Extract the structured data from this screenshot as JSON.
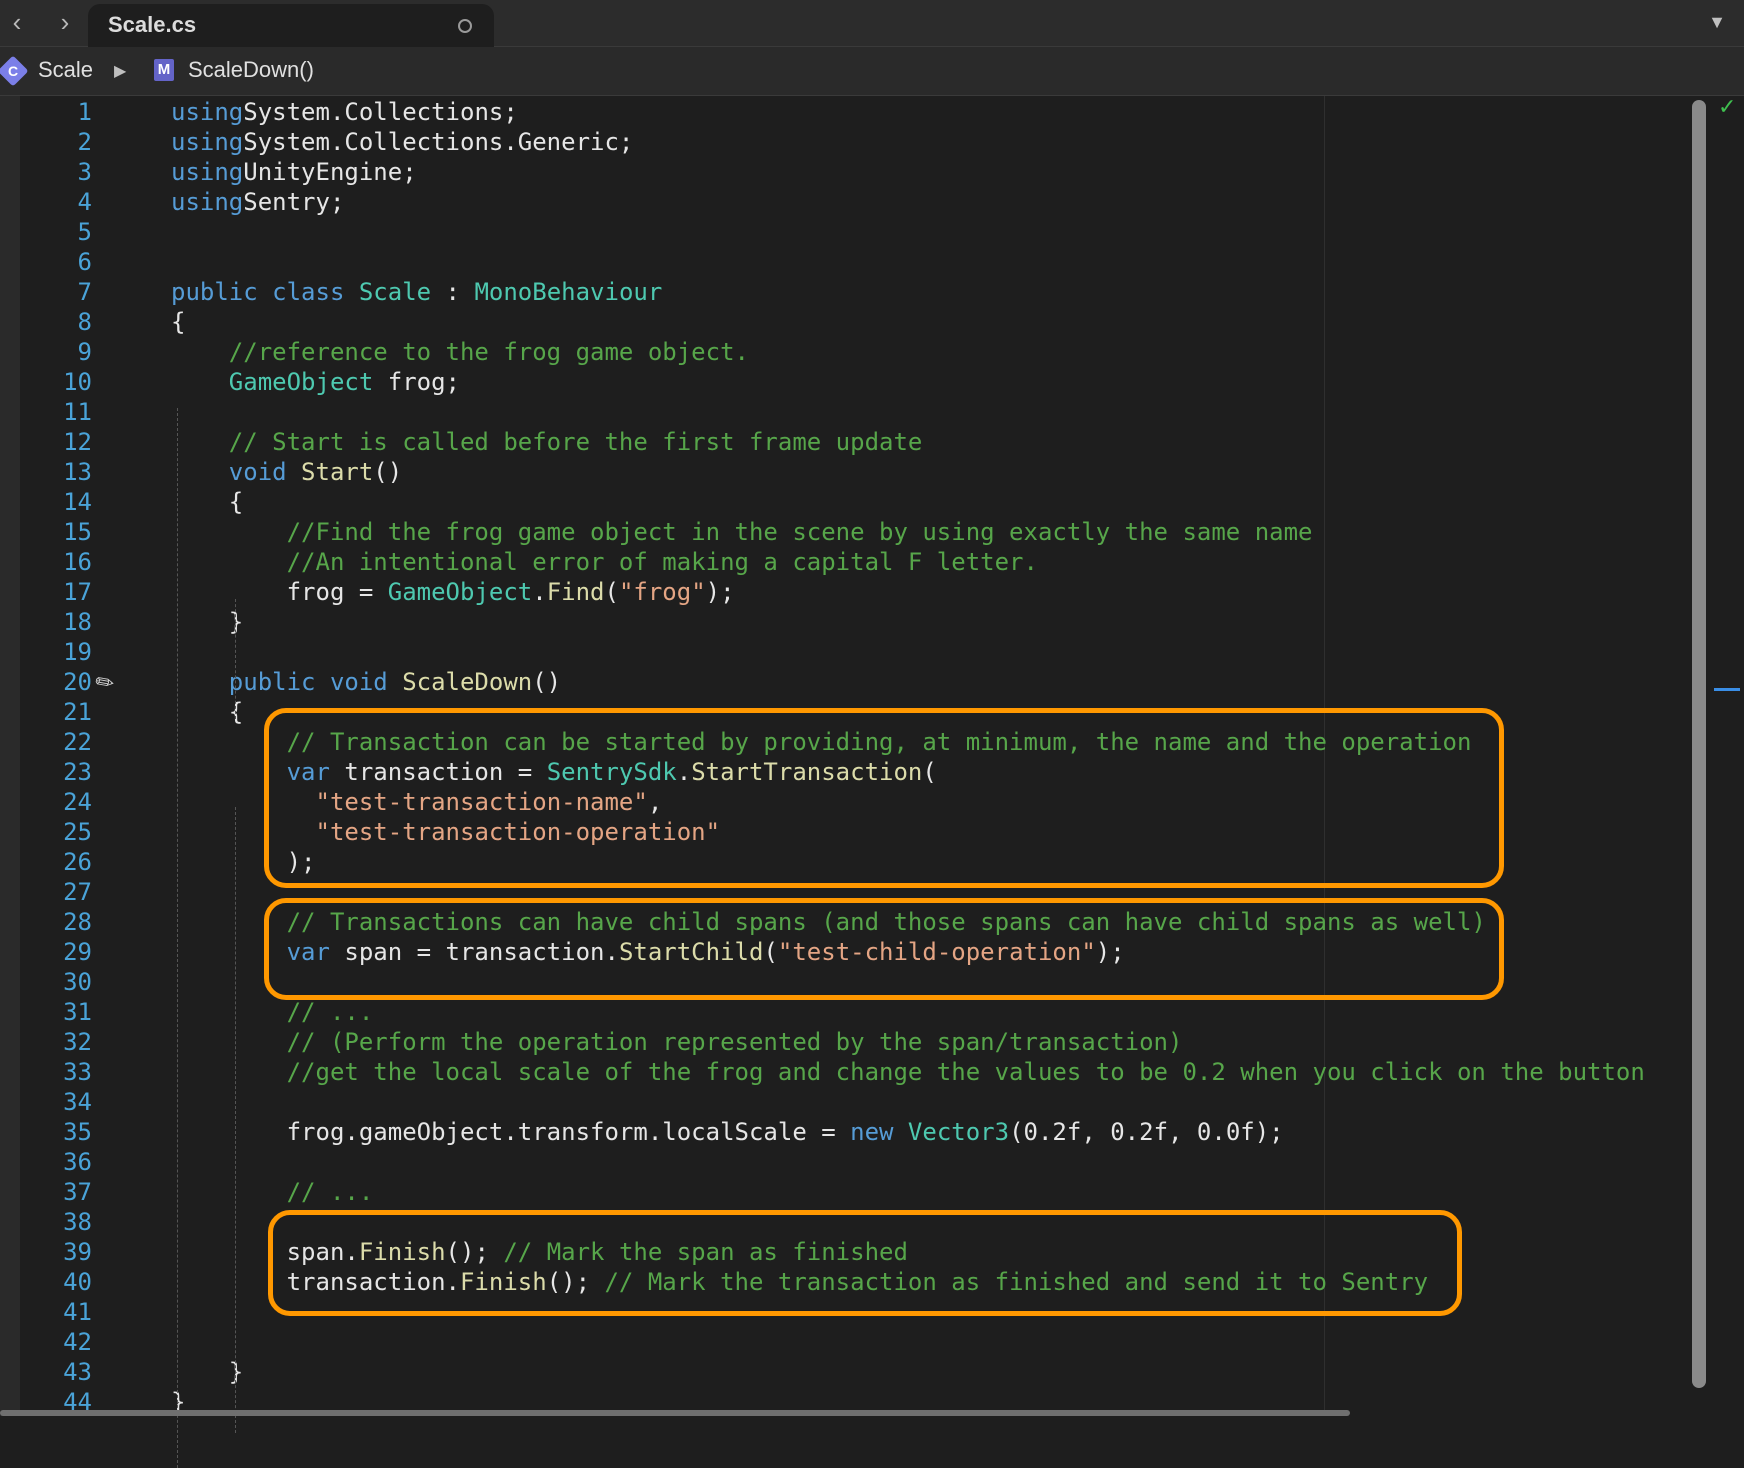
{
  "tabbar": {
    "back": "‹",
    "forward": "›",
    "tab_title": "Scale.cs",
    "menu": "▼"
  },
  "breadcrumb": {
    "class_icon": "C",
    "class_name": "Scale",
    "separator": "▶",
    "method_icon": "M",
    "method_name": "ScaleDown()"
  },
  "editor": {
    "line_numbers": [
      "1",
      "2",
      "3",
      "4",
      "5",
      "6",
      "7",
      "8",
      "9",
      "10",
      "11",
      "12",
      "13",
      "14",
      "15",
      "16",
      "17",
      "18",
      "19",
      "20",
      "21",
      "22",
      "23",
      "24",
      "25",
      "26",
      "27",
      "28",
      "29",
      "30",
      "31",
      "32",
      "33",
      "34",
      "35",
      "36",
      "37",
      "38",
      "39",
      "40",
      "41",
      "42",
      "43",
      "44"
    ],
    "lines": [
      [
        [
          "kw",
          "using"
        ],
        [
          "",
          "System.Collections;"
        ]
      ],
      [
        [
          "kw",
          "using"
        ],
        [
          "",
          "System.Collections.Generic;"
        ]
      ],
      [
        [
          "kw",
          "using"
        ],
        [
          "",
          "UnityEngine;"
        ]
      ],
      [
        [
          "kw",
          "using"
        ],
        [
          "",
          "Sentry;"
        ]
      ],
      [],
      [],
      [
        [
          "kw",
          "public class "
        ],
        [
          "ty",
          "Scale"
        ],
        [
          "",
          " : "
        ],
        [
          "ty",
          "MonoBehaviour"
        ]
      ],
      [
        [
          "",
          "{"
        ]
      ],
      [
        [
          "",
          "    "
        ],
        [
          "cm",
          "//reference to the frog game object."
        ]
      ],
      [
        [
          "",
          "    "
        ],
        [
          "ty",
          "GameObject"
        ],
        [
          "",
          " frog;"
        ]
      ],
      [],
      [
        [
          "",
          "    "
        ],
        [
          "cm",
          "// Start is called before the first frame update"
        ]
      ],
      [
        [
          "",
          "    "
        ],
        [
          "kw",
          "void "
        ],
        [
          "fn",
          "Start"
        ],
        [
          "",
          "()"
        ]
      ],
      [
        [
          "",
          "    {"
        ]
      ],
      [
        [
          "",
          "        "
        ],
        [
          "cm",
          "//Find the frog game object in the scene by using exactly the same name"
        ]
      ],
      [
        [
          "",
          "        "
        ],
        [
          "cm",
          "//An intentional error of making a capital F letter."
        ]
      ],
      [
        [
          "",
          "        frog = "
        ],
        [
          "ty",
          "GameObject"
        ],
        [
          "",
          "."
        ],
        [
          "fn",
          "Find"
        ],
        [
          "",
          "("
        ],
        [
          "str",
          "\"frog\""
        ],
        [
          "",
          ");"
        ]
      ],
      [
        [
          "",
          "    }"
        ]
      ],
      [],
      [
        [
          "",
          "    "
        ],
        [
          "kw",
          "public void "
        ],
        [
          "fn",
          "ScaleDown"
        ],
        [
          "",
          "()"
        ]
      ],
      [
        [
          "",
          "    {"
        ]
      ],
      [
        [
          "",
          "        "
        ],
        [
          "cm",
          "// Transaction can be started by providing, at minimum, the name and the operation"
        ]
      ],
      [
        [
          "",
          "        "
        ],
        [
          "kw",
          "var "
        ],
        [
          "",
          "transaction = "
        ],
        [
          "ty",
          "SentrySdk"
        ],
        [
          "",
          "."
        ],
        [
          "fn",
          "StartTransaction"
        ],
        [
          "",
          "("
        ]
      ],
      [
        [
          "",
          "          "
        ],
        [
          "str",
          "\"test-transaction-name\""
        ],
        [
          "",
          ","
        ]
      ],
      [
        [
          "",
          "          "
        ],
        [
          "str",
          "\"test-transaction-operation\""
        ]
      ],
      [
        [
          "",
          "        );"
        ]
      ],
      [],
      [
        [
          "",
          "        "
        ],
        [
          "cm",
          "// Transactions can have child spans (and those spans can have child spans as well)"
        ]
      ],
      [
        [
          "",
          "        "
        ],
        [
          "kw",
          "var "
        ],
        [
          "",
          "span = transaction."
        ],
        [
          "fn",
          "StartChild"
        ],
        [
          "",
          "("
        ],
        [
          "str",
          "\"test-child-operation\""
        ],
        [
          "",
          ");"
        ]
      ],
      [],
      [
        [
          "",
          "        "
        ],
        [
          "cm",
          "// ..."
        ]
      ],
      [
        [
          "",
          "        "
        ],
        [
          "cm",
          "// (Perform the operation represented by the span/transaction)"
        ]
      ],
      [
        [
          "",
          "        "
        ],
        [
          "cm",
          "//get the local scale of the frog and change the values to be 0.2 when you click on the button"
        ]
      ],
      [],
      [
        [
          "",
          "        frog.gameObject.transform.localScale = "
        ],
        [
          "kw",
          "new "
        ],
        [
          "ty",
          "Vector3"
        ],
        [
          "",
          "(0.2f, 0.2f, 0.0f);"
        ]
      ],
      [],
      [
        [
          "",
          "        "
        ],
        [
          "cm",
          "// ..."
        ]
      ],
      [],
      [
        [
          "",
          "        span."
        ],
        [
          "fn",
          "Finish"
        ],
        [
          "",
          "(); "
        ],
        [
          "cm",
          "// Mark the span as finished"
        ]
      ],
      [
        [
          "",
          "        transaction."
        ],
        [
          "fn",
          "Finish"
        ],
        [
          "",
          "(); "
        ],
        [
          "cm",
          "// Mark the transaction as finished and send it to Sentry"
        ]
      ],
      [],
      [],
      [
        [
          "",
          "    }"
        ]
      ],
      [
        [
          "",
          "}"
        ]
      ]
    ]
  },
  "icons": {
    "check": "✓",
    "breakpoint": "✎"
  },
  "colors": {
    "highlight_box": "#ff9800",
    "keyword": "#569cd6",
    "type": "#4ec9b0",
    "function": "#dcdcaa",
    "string": "#e4a584",
    "comment": "#57a64a",
    "line_number": "#4aa3d8"
  }
}
